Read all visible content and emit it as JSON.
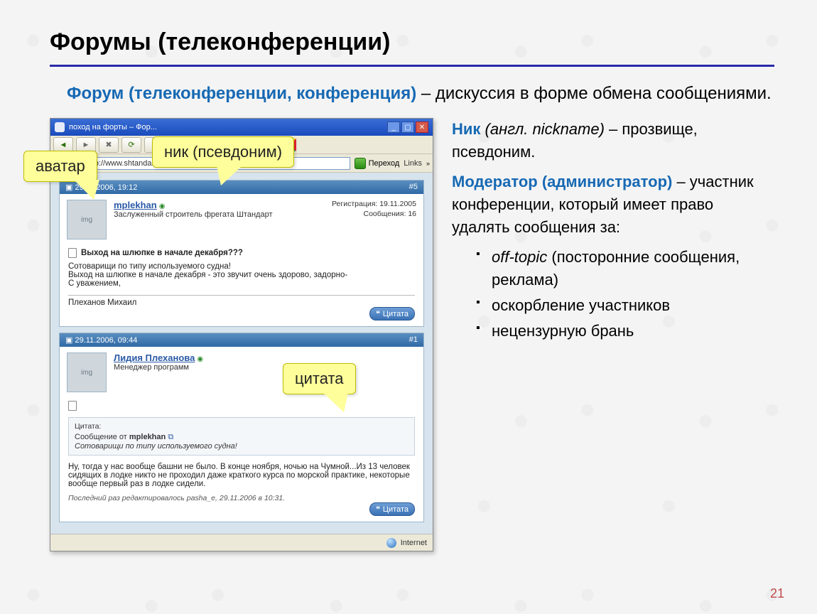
{
  "pagenum": "21",
  "title": "Форумы (телеконференции)",
  "lead_term": "Форум (телеконференции, конференция) ",
  "lead_dash": "– ",
  "lead_rest": "дискуссия в форме обмена сообщениями.",
  "callouts": {
    "avatar": "аватар",
    "nick": "ник (псевдоним)",
    "quote": "цитата"
  },
  "browser": {
    "title": "поход на форты – Фор...",
    "addr_label": "Адрес:",
    "url": "http://www.shtandart.ru/forum              t=436",
    "go_label": "Переход",
    "links_label": "Links",
    "status_text": "Internet"
  },
  "post1": {
    "hdr_date": "29.11.2006, 19:12",
    "hdr_num": "#5",
    "username": "mplekhan",
    "status": "◉",
    "role": "Заслуженный строитель фрегата Штандарт",
    "reg": "Регистрация: 19.11.2005",
    "msgs": "Сообщения: 16",
    "subject": "Выход на шлюпке в начале декабря???",
    "line1": "Сотоварищи по типу используемого судна!",
    "line2": "Выход на шлюпке в начале декабря - это звучит очень здорово, задорно-",
    "line3": "С уважением,",
    "sig": "Плеханов Михаил",
    "quote_btn": "Цитата"
  },
  "post2": {
    "hdr_date": "29.11.2006, 09:44",
    "hdr_num": "#1",
    "username": "Лидия Плеханова",
    "status": "◉",
    "role": "Менеджер программ",
    "q_label": "Цитата:",
    "q_from_pre": "Сообщение от ",
    "q_from_user": "mplekhan",
    "q_text": "Сотоварищи по типу используемого судна!",
    "body": "Ну, тогда у нас вообще башни не было. В конце ноября, ночью на Чумной...Из 13 человек сидящих в лодке никто не проходил даже краткого курса по морской практике, некоторые вообще первый раз в лодке сидели.",
    "edited_pre": "Последний раз редактировалось pasha_e, 29.11.2006 в ",
    "edited_time": "10:31.",
    "quote_btn": "Цитата"
  },
  "right": {
    "nick_term": "Ник ",
    "nick_en": "(англ. nickname) ",
    "nick_rest": "– прозвище, псевдоним.",
    "mod_term": "Модератор (администратор) ",
    "mod_rest": "– участник конференции, который имеет право удалять сообщения за:",
    "li1_em": "off-topic",
    "li1_rest": " (посторонние сообщения, реклама)",
    "li2": "оскорбление участников",
    "li3": "нецензурную брань"
  }
}
